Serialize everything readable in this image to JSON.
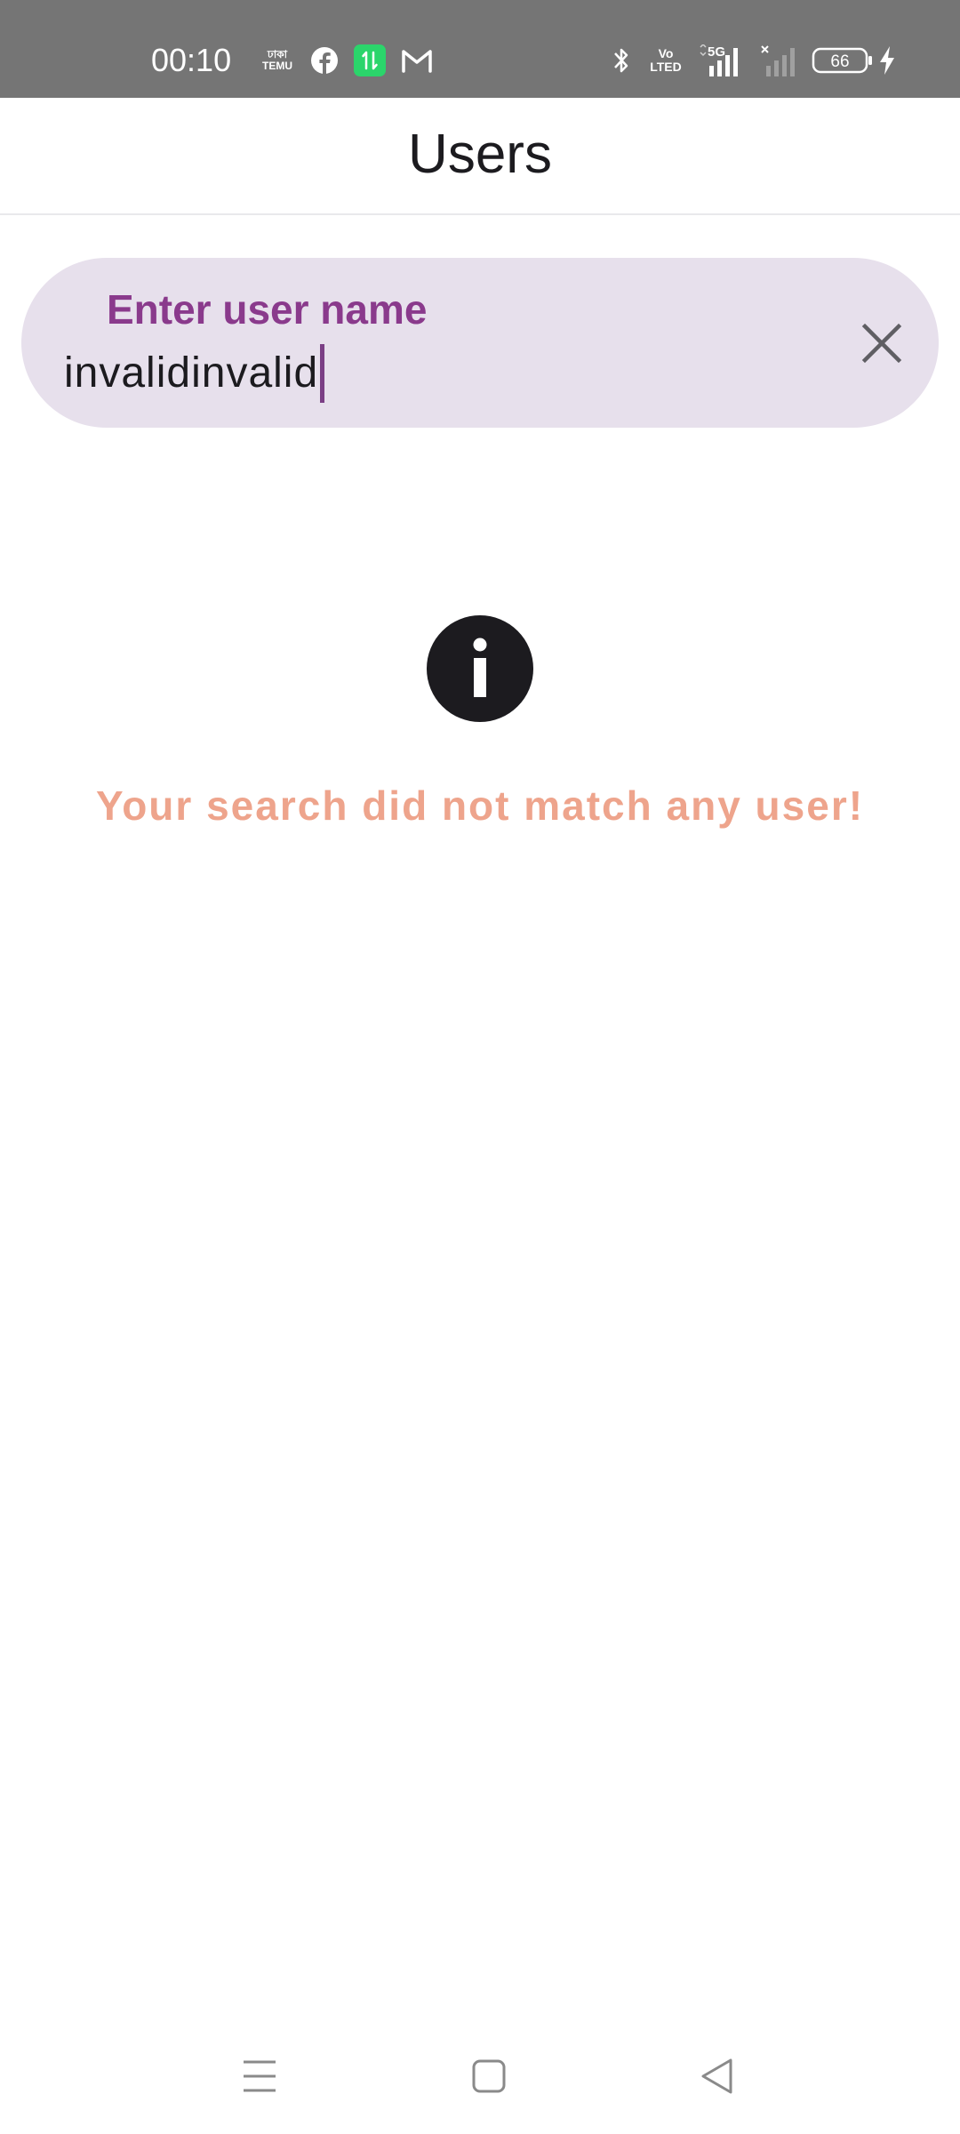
{
  "status_bar": {
    "time": "00:10",
    "temu_top": "ঢাকা",
    "temu_bottom": "TEMU",
    "volte_top": "Vo",
    "volte_bottom": "LTED",
    "network": "5G",
    "battery": "66",
    "icons": [
      "temu-icon",
      "facebook-icon",
      "data-transfer-icon",
      "mail-icon",
      "bluetooth-icon",
      "volte-icon",
      "signal-5g-icon",
      "signal-no-service-icon",
      "battery-icon",
      "charging-icon"
    ]
  },
  "app_bar": {
    "title": "Users"
  },
  "search": {
    "label": "Enter user name",
    "value": "invalidinvalid",
    "clear_icon": "close-icon"
  },
  "empty_state": {
    "icon": "info-icon",
    "message": "Your search did not match any user!"
  },
  "navigation": {
    "icons": [
      "menu-icon",
      "home-icon",
      "back-icon"
    ]
  },
  "colors": {
    "status_bar_bg": "#757575",
    "search_bg": "#e7e0ec",
    "label_accent": "#8a3a8c",
    "message": "#eea48c",
    "text": "#1c1b1f"
  }
}
